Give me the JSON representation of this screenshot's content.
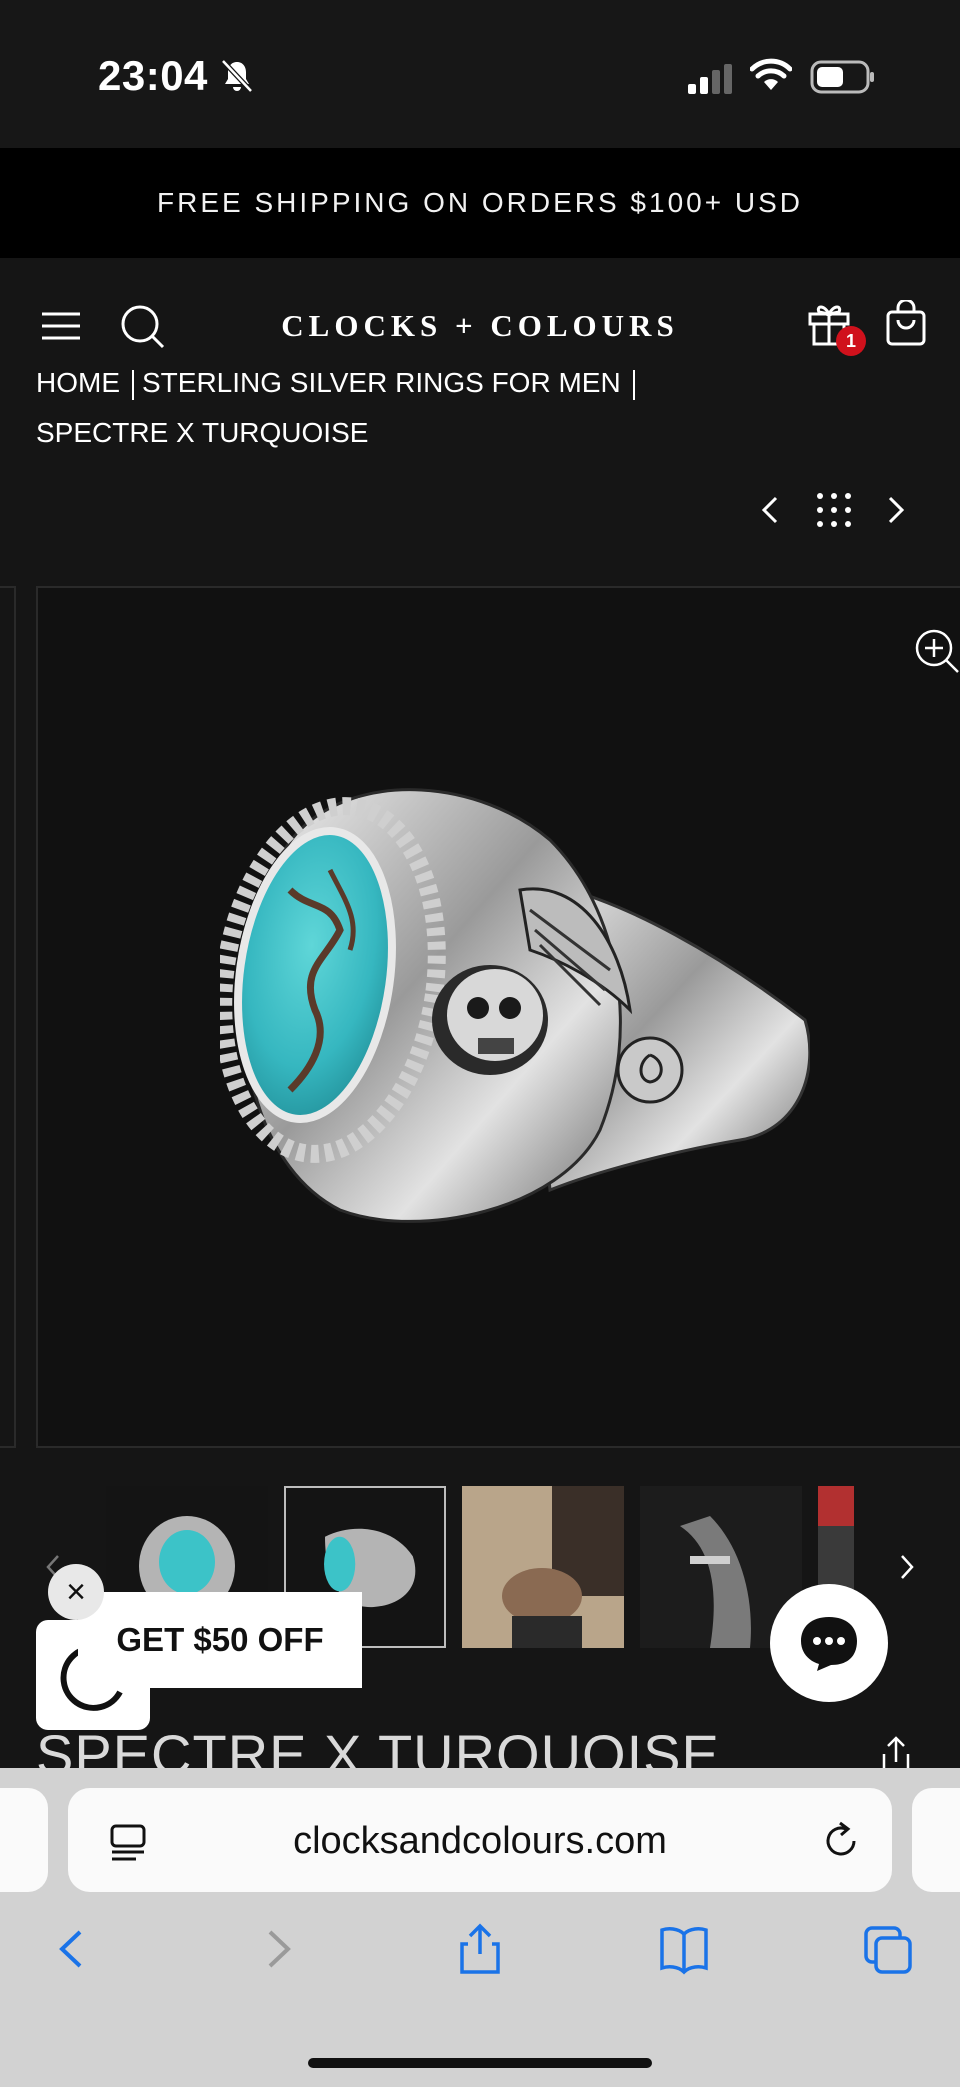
{
  "status_bar": {
    "time": "23:04"
  },
  "promo": {
    "text": "FREE SHIPPING ON ORDERS $100+ USD"
  },
  "header": {
    "logo": "CLOCKS + COLOURS",
    "gift_badge_count": "1"
  },
  "breadcrumb": {
    "items": [
      "HOME",
      "STERLING SILVER RINGS FOR MEN",
      "SPECTRE X TURQUOISE"
    ]
  },
  "product": {
    "title": "SPECTRE X TURQUOISE"
  },
  "popup": {
    "close_label": "×",
    "offer": "GET $50 OFF"
  },
  "browser": {
    "url": "clocksandcolours.com"
  },
  "colors": {
    "background": "#151515",
    "promo_bar": "#000000",
    "badge": "#d0111c",
    "turquoise": "#3cc3c8",
    "browser_chrome": "#d2d2d2",
    "ios_blue": "#1a73e8"
  },
  "icons": [
    "bell-slash-icon",
    "signal-icon",
    "wifi-icon",
    "battery-icon",
    "menu-icon",
    "search-icon",
    "gift-icon",
    "bag-icon",
    "chevron-left-icon",
    "grid-icon",
    "chevron-right-icon",
    "zoom-in-icon",
    "share-icon",
    "chat-icon",
    "reader-icon",
    "reload-icon",
    "back-icon",
    "forward-icon",
    "bookmarks-icon",
    "tabs-icon"
  ]
}
